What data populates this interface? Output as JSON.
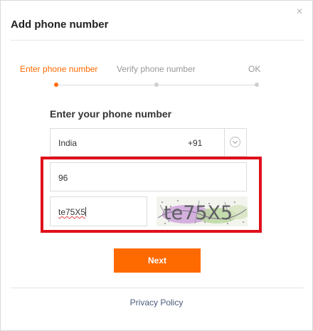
{
  "dialog": {
    "title": "Add phone number",
    "close_icon": "close-icon"
  },
  "steps": [
    {
      "label": "Enter phone number",
      "active": true
    },
    {
      "label": "Verify phone number",
      "active": false
    },
    {
      "label": "OK",
      "active": false
    }
  ],
  "form": {
    "heading": "Enter your phone number",
    "country": {
      "name": "India",
      "code": "+91",
      "dropdown_icon": "chevron-down-icon"
    },
    "phone": {
      "value": "96"
    },
    "captcha": {
      "value": "te75X5",
      "image_text": "te75X5"
    },
    "next_label": "Next"
  },
  "footer": {
    "privacy_label": "Privacy Policy"
  },
  "colors": {
    "accent": "#ff6a00",
    "highlight_border": "#e0101b",
    "link": "#4a5b7a"
  }
}
